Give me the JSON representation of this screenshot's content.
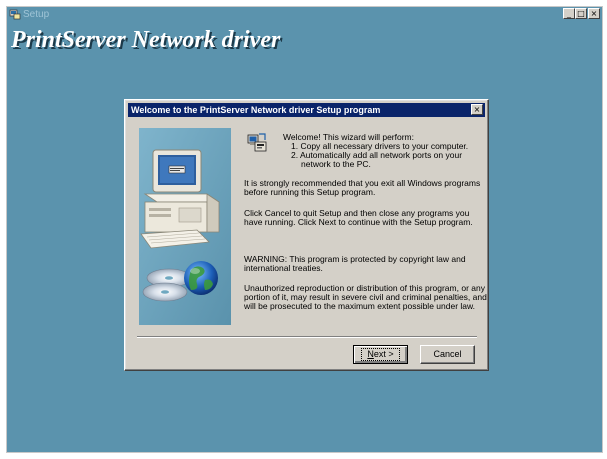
{
  "window": {
    "title": "Setup",
    "banner": "PrintServer Network driver",
    "minimize_label": "_",
    "maximize_label": "□",
    "close_label": "×"
  },
  "dialog": {
    "title": "Welcome to the PrintServer Network driver Setup program",
    "close_label": "×",
    "intro": "Welcome! This wizard will perform:",
    "steps": [
      "1. Copy all necessary drivers to your computer.",
      "2. Automatically add all network ports on your",
      "network to the PC."
    ],
    "recommend": [
      "It is strongly recommended that you exit all Windows programs",
      "before running this Setup program."
    ],
    "cancel_info": [
      "Click Cancel to quit Setup and then close any programs you",
      "have running.  Click Next to continue with the Setup program."
    ],
    "warning": [
      "WARNING: This program is protected by copyright law and",
      "international treaties."
    ],
    "penalty": [
      "Unauthorized reproduction or distribution of this program, or any",
      "portion of it, may result in severe civil and criminal penalties, and",
      "will be prosecuted to the maximum extent possible under law."
    ],
    "buttons": {
      "next_underline": "N",
      "next_rest": "ext >",
      "cancel": "Cancel"
    }
  },
  "icons": {
    "app": "setup-app-icon",
    "wizard": "install-computer-icon",
    "side_image": "computer-with-cd-illustration"
  }
}
